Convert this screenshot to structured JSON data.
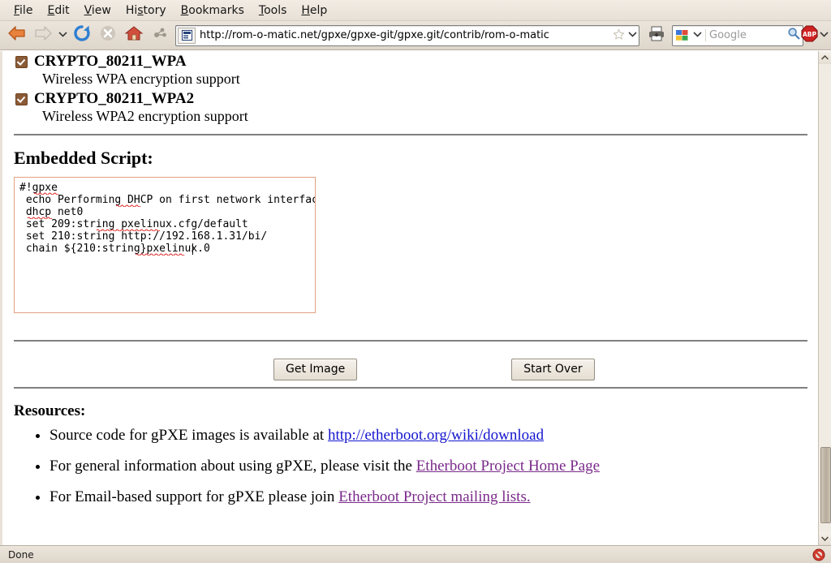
{
  "browser": {
    "menubar": [
      {
        "label": "File",
        "accesskey": "F"
      },
      {
        "label": "Edit",
        "accesskey": "E"
      },
      {
        "label": "View",
        "accesskey": "V"
      },
      {
        "label": "History",
        "accesskey": "s"
      },
      {
        "label": "Bookmarks",
        "accesskey": "B"
      },
      {
        "label": "Tools",
        "accesskey": "T"
      },
      {
        "label": "Help",
        "accesskey": "H"
      }
    ],
    "toolbar": {
      "back_icon": "back-arrow-icon",
      "forward_icon": "forward-arrow-icon",
      "history_dropdown_icon": "chevron-down-icon",
      "reload_icon": "reload-icon",
      "stop_icon": "stop-icon",
      "home_icon": "home-icon",
      "feed_icon": "feed-icon",
      "print_icon": "print-icon"
    },
    "url": "http://rom-o-matic.net/gpxe/gpxe-git/gpxe.git/contrib/rom-o-matic",
    "url_favicon": "page-favicon-icon",
    "bookmark_star_icon": "star-icon",
    "url_dropdown_icon": "chevron-down-icon",
    "search": {
      "engine": "Google",
      "placeholder": "Google",
      "value": "",
      "engine_icon": "google-icon",
      "go_icon": "magnifier-icon"
    },
    "adblock": {
      "label": "ABP",
      "icon": "adblock-plus-icon",
      "dropdown_icon": "chevron-down-icon"
    },
    "status": {
      "text": "Done",
      "noscript_icon": "noscript-blocked-icon"
    },
    "scrollbar": {
      "up_arrow": "▲",
      "down_arrow": "▼",
      "position_percent": 83
    }
  },
  "page": {
    "options": [
      {
        "name": "CRYPTO_80211_WPA",
        "description": "Wireless WPA encryption support",
        "checked": true
      },
      {
        "name": "CRYPTO_80211_WPA2",
        "description": "Wireless WPA2 encryption support",
        "checked": true
      }
    ],
    "embedded_script": {
      "heading": "Embedded Script:",
      "value": "#!gpxe\n echo Performing DHCP on first network interface\n dhcp net0\n set 209:string pxelinux.cfg/default\n set 210:string http://192.168.1.31/bi/\n chain ${210:string}pxelinux.0",
      "misspelled_words": [
        "gpxe",
        "DHCP",
        "dhcp",
        "pxelinux.cfg",
        "pxelinux"
      ]
    },
    "buttons": {
      "get_image": "Get Image",
      "start_over": "Start Over"
    },
    "resources": {
      "heading": "Resources:",
      "items": [
        {
          "text_before": "Source code for gPXE images is available at ",
          "link": "http://etherboot.org/wiki/download",
          "text_after": "",
          "visited": false
        },
        {
          "text_before": "For general information about using gPXE, please visit the ",
          "link": "Etherboot Project Home Page",
          "text_after": "",
          "visited": true
        },
        {
          "text_before": "For Email-based support for gPXE please join ",
          "link": "Etherboot Project mailing lists.",
          "text_after": "",
          "visited": true
        }
      ]
    }
  }
}
